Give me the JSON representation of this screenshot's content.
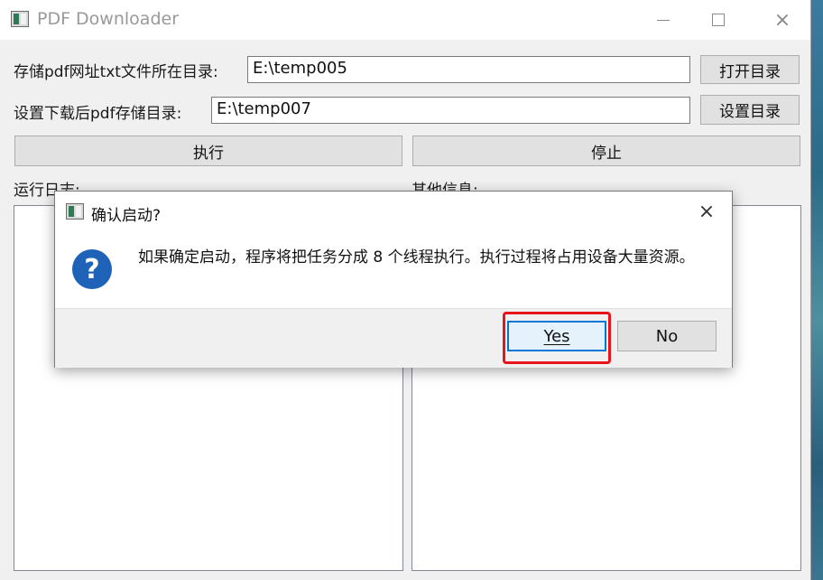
{
  "window": {
    "title": "PDF Downloader",
    "controls": {
      "minimize": "minimize",
      "maximize": "maximize",
      "close": "×"
    }
  },
  "form": {
    "source_dir_label": "存储pdf网址txt文件所在目录:",
    "source_dir_value": "E:\\temp005",
    "open_dir_button": "打开目录",
    "save_dir_label": "设置下载后pdf存储目录:",
    "save_dir_value": "E:\\temp007",
    "set_dir_button": "设置目录",
    "execute_button": "执行",
    "stop_button": "停止",
    "log_label": "运行日志:",
    "info_label": "其他信息:"
  },
  "dialog": {
    "title": "确认启动?",
    "close": "×",
    "icon": "question-icon",
    "message": "如果确定启动，程序将把任务分成 8 个线程执行。执行过程将占用设备大量资源。",
    "yes_button": "Yes",
    "no_button": "No"
  },
  "colors": {
    "accent": "#0078d7",
    "highlight": "#e8141c",
    "question_icon": "#1f63b8"
  }
}
